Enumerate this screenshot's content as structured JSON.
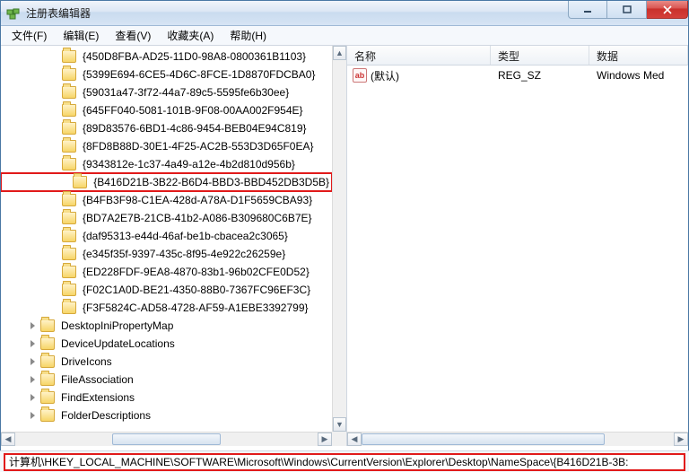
{
  "window": {
    "title": "注册表编辑器"
  },
  "menus": [
    {
      "label": "文件(F)"
    },
    {
      "label": "编辑(E)"
    },
    {
      "label": "查看(V)"
    },
    {
      "label": "收藏夹(A)"
    },
    {
      "label": "帮助(H)"
    }
  ],
  "tree": {
    "guid_level_indent": 66,
    "folder_level_indent": 28,
    "guids": [
      "{450D8FBA-AD25-11D0-98A8-0800361B1103}",
      "{5399E694-6CE5-4D6C-8FCE-1D8870FDCBA0}",
      "{59031a47-3f72-44a7-89c5-5595fe6b30ee}",
      "{645FF040-5081-101B-9F08-00AA002F954E}",
      "{89D83576-6BD1-4c86-9454-BEB04E94C819}",
      "{8FD8B88D-30E1-4F25-AC2B-553D3D65F0EA}",
      "{9343812e-1c37-4a49-a12e-4b2d810d956b}",
      "{B416D21B-3B22-B6D4-BBD3-BBD452DB3D5B}",
      "{B4FB3F98-C1EA-428d-A78A-D1F5659CBA93}",
      "{BD7A2E7B-21CB-41b2-A086-B309680C6B7E}",
      "{daf95313-e44d-46af-be1b-cbacea2c3065}",
      "{e345f35f-9397-435c-8f95-4e922c26259e}",
      "{ED228FDF-9EA8-4870-83b1-96b02CFE0D52}",
      "{F02C1A0D-BE21-4350-88B0-7367FC96EF3C}",
      "{F3F5824C-AD58-4728-AF59-A1EBE3392799}"
    ],
    "highlighted_index": 7,
    "folders": [
      "DesktopIniPropertyMap",
      "DeviceUpdateLocations",
      "DriveIcons",
      "FileAssociation",
      "FindExtensions",
      "FolderDescriptions"
    ]
  },
  "list": {
    "columns": {
      "name": "名称",
      "type": "类型",
      "data": "数据"
    },
    "rows": [
      {
        "icon": "ab",
        "name": "(默认)",
        "type": "REG_SZ",
        "data": "Windows Med"
      }
    ]
  },
  "tree_hscroll": {
    "thumb_left_pct": 32,
    "thumb_width_pct": 36
  },
  "list_hscroll": {
    "thumb_left_pct": 0,
    "thumb_width_pct": 78
  },
  "status": {
    "path": "计算机\\HKEY_LOCAL_MACHINE\\SOFTWARE\\Microsoft\\Windows\\CurrentVersion\\Explorer\\Desktop\\NameSpace\\{B416D21B-3B:"
  }
}
